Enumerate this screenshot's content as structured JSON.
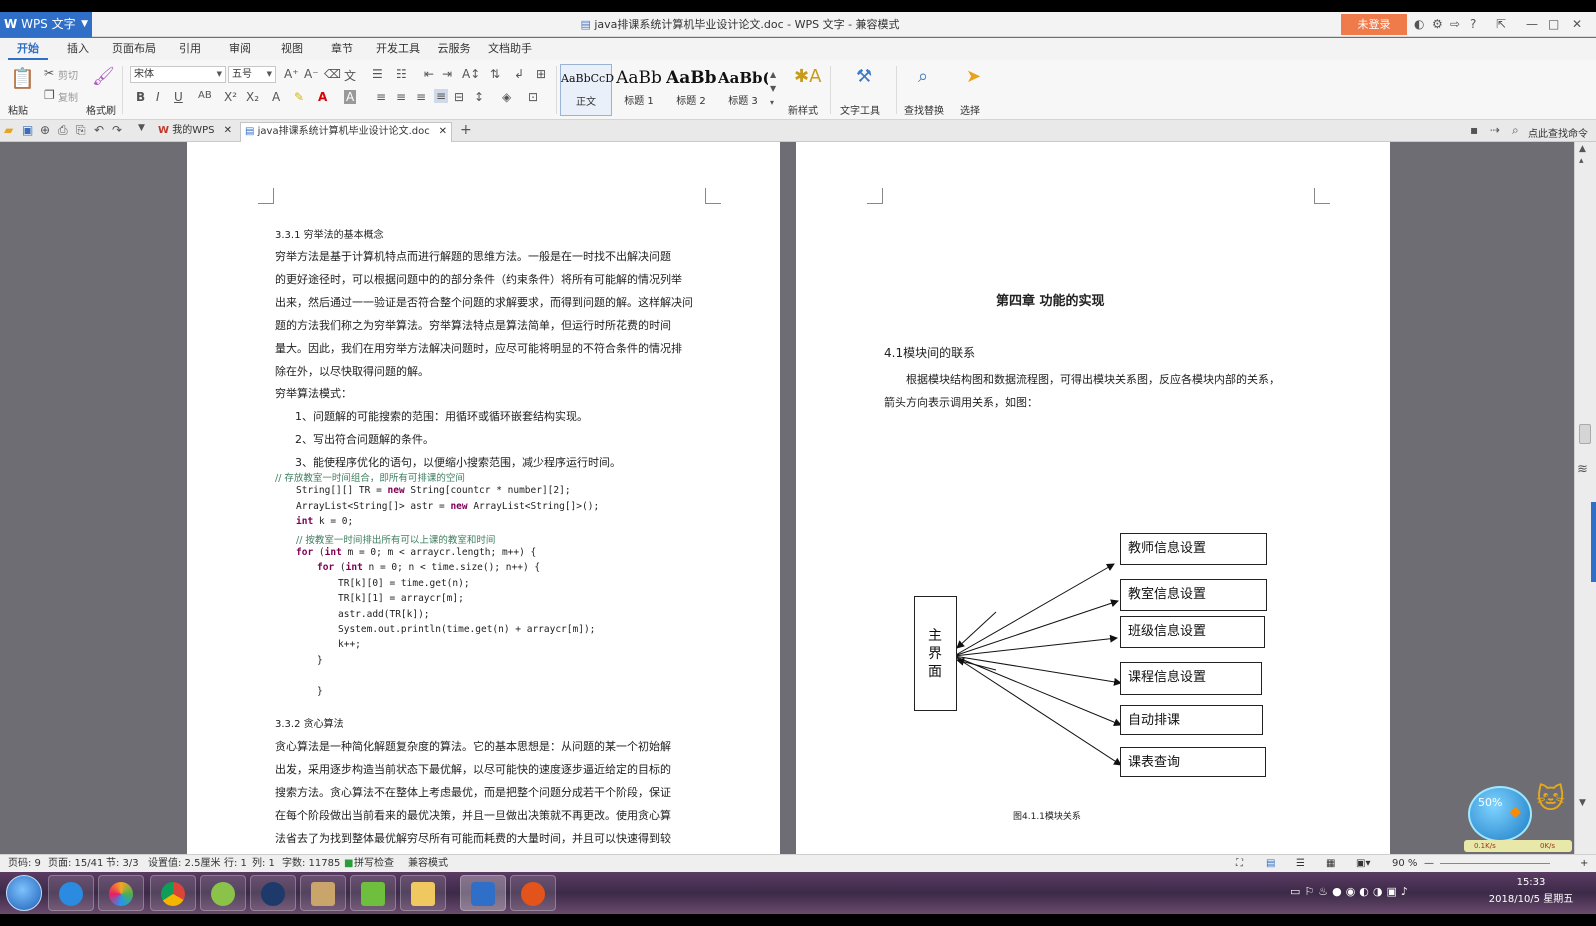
{
  "app": {
    "name": "WPS 文字",
    "doc_title": "java排课系统计算机毕业设计论文.doc - WPS 文字 - 兼容模式",
    "login": "未登录"
  },
  "menu": [
    "开始",
    "插入",
    "页面布局",
    "引用",
    "审阅",
    "视图",
    "章节",
    "开发工具",
    "云服务",
    "文档助手"
  ],
  "ribbon": {
    "paste": "粘贴",
    "cut": "剪切",
    "copy": "复制",
    "format_painter": "格式刷",
    "font_name": "宋体",
    "font_size": "五号",
    "styles": [
      {
        "preview": "AaBbCcD",
        "name": "正文"
      },
      {
        "preview": "AaBb",
        "name": "标题 1"
      },
      {
        "preview": "AaBb(",
        "name": "标题 2"
      },
      {
        "preview": "AaBb(",
        "name": "标题 3"
      }
    ],
    "new_style": "新样式",
    "text_tools": "文字工具",
    "find_replace": "查找替换",
    "select": "选择"
  },
  "tabs": {
    "my_wps": "我的WPS",
    "doc": "java排课系统计算机毕业设计论文.doc",
    "search_cmd": "点此查找命令"
  },
  "page1": {
    "heading1": "3.3.1 穷举法的基本概念",
    "para1": [
      "穷举方法是基于计算机特点而进行解题的思维方法。一般是在一时找不出解决问题",
      "的更好途径时，可以根据问题中的的部分条件（约束条件）将所有可能解的情况列举",
      "出来，然后通过一一验证是否符合整个问题的求解要求，而得到问题的解。这样解决问",
      "题的方法我们称之为穷举算法。穷举算法特点是算法简单，但运行时所花费的时间",
      "量大。因此，我们在用穷举方法解决问题时，应尽可能将明显的不符合条件的情况排",
      "除在外，以尽快取得问题的解。"
    ],
    "mode_title": "穷举算法模式：",
    "modes": [
      "1、问题解的可能搜索的范围：用循环或循环嵌套结构实现。",
      "2、写出符合问题解的条件。",
      "3、能使程序优化的语句，以便缩小搜索范围，减少程序运行时间。"
    ],
    "code": [
      {
        "indent": 0,
        "text": "// 存放教室一时间组合，即所有可排课的空间",
        "type": "comment"
      },
      {
        "indent": 1,
        "text": "String[][] TR = new String[countcr * number][2];",
        "type": "code"
      },
      {
        "indent": 1,
        "text": "ArrayList<String[]> astr = new ArrayList<String[]>();",
        "type": "code"
      },
      {
        "indent": 1,
        "text": "int k = 0;",
        "type": "code"
      },
      {
        "indent": 1,
        "text": "// 按教室一时间排出所有可以上课的教室和时间",
        "type": "comment"
      },
      {
        "indent": 1,
        "text": "for (int m = 0; m < arraycr.length; m++) {",
        "type": "code"
      },
      {
        "indent": 2,
        "text": "for (int n = 0; n < time.size(); n++) {",
        "type": "code"
      },
      {
        "indent": 3,
        "text": "TR[k][0] = time.get(n);",
        "type": "code"
      },
      {
        "indent": 3,
        "text": "TR[k][1] = arraycr[m];",
        "type": "code"
      },
      {
        "indent": 3,
        "text": "astr.add(TR[k]);",
        "type": "code"
      },
      {
        "indent": 3,
        "text": "System.out.println(time.get(n) + arraycr[m]);",
        "type": "code"
      },
      {
        "indent": 3,
        "text": "k++;",
        "type": "code"
      },
      {
        "indent": 2,
        "text": "}",
        "type": "code"
      },
      {
        "indent": 2,
        "text": "",
        "type": "code"
      },
      {
        "indent": 2,
        "text": "}",
        "type": "code"
      }
    ],
    "heading2": "3.3.2 贪心算法",
    "para2": [
      "贪心算法是一种简化解题复杂度的算法。它的基本思想是：从问题的某一个初始解",
      "出发，采用逐步构造当前状态下最优解，以尽可能快的速度逐步逼近给定的目标的",
      "搜索方法。贪心算法不在整体上考虑最优，而是把整个问题分成若干个阶段，保证",
      "在每个阶段做出当前看来的最优决策，并且一旦做出决策就不再更改。使用贪心算",
      "法省去了为找到整体最优解穷尽所有可能而耗费的大量时间，并且可以快速得到较"
    ]
  },
  "page2": {
    "chapter": "第四章  功能的实现",
    "section": "4.1模块间的联系",
    "para": [
      "根据模块结构图和数据流程图，可得出模块关系图，反应各模块内部的关系，",
      "箭头方向表示调用关系，如图："
    ],
    "main_box": "主界面",
    "modules": [
      "教师信息设置",
      "教室信息设置",
      "班级信息设置",
      "课程信息设置",
      "自动排课",
      "课表查询"
    ],
    "caption": "图4.1.1模块关系"
  },
  "status": {
    "page_no": "页码: 9",
    "pages": "页面: 15/41",
    "section": "节: 3/3",
    "setting": "设置值: 2.5厘米",
    "row": "行: 1",
    "col": "列: 1",
    "words": "字数: 11785",
    "spell": "拼写检查",
    "compat": "兼容模式",
    "zoom": "90 %"
  },
  "widget": {
    "percent": "50%",
    "down": "0.1K/s",
    "up": "0K/s"
  },
  "clock": {
    "time": "15:33",
    "date": "2018/10/5 星期五"
  },
  "colors": {
    "wps_blue": "#2f6fc7",
    "login_orange": "#ef7b4b",
    "code_comment": "#3f7f5f",
    "code_keyword": "#7f0055"
  }
}
